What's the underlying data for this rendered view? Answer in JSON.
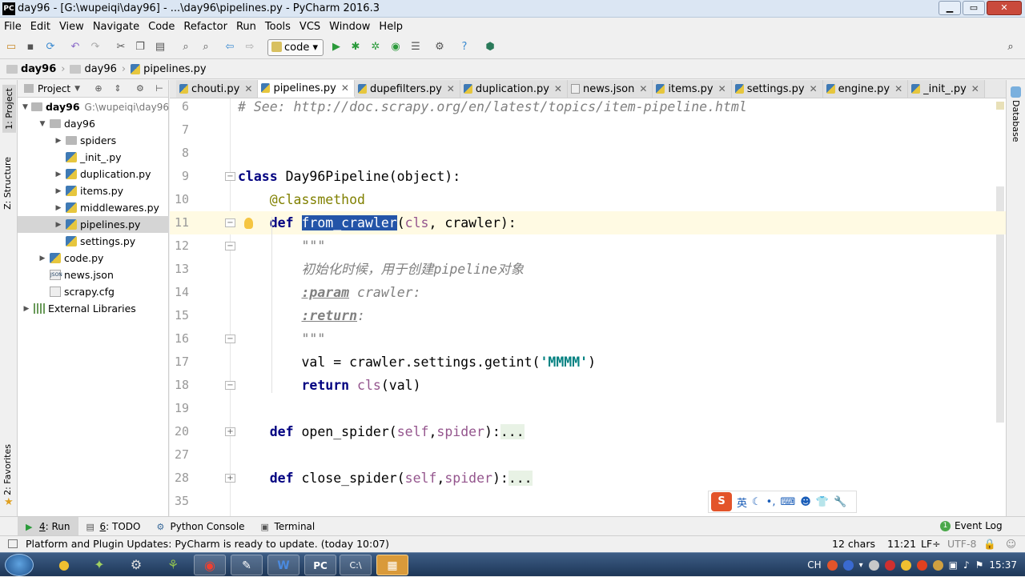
{
  "window": {
    "title": "day96 - [G:\\wupeiqi\\day96] - ...\\day96\\pipelines.py - PyCharm 2016.3",
    "app_icon": "PC"
  },
  "menu": [
    "File",
    "Edit",
    "View",
    "Navigate",
    "Code",
    "Refactor",
    "Run",
    "Tools",
    "VCS",
    "Window",
    "Help"
  ],
  "toolbar": {
    "run_config": "code"
  },
  "breadcrumb": [
    "day96",
    "day96",
    "pipelines.py"
  ],
  "side_tabs": {
    "project": "1: Project",
    "structure": "Z: Structure",
    "favorites": "2: Favorites",
    "database": "Database"
  },
  "project_panel": {
    "header": "Project",
    "tree": [
      {
        "label": "day96",
        "path": "G:\\wupeiqi\\day96",
        "type": "folder",
        "arrow": "▼",
        "indent": 0,
        "bold": true
      },
      {
        "label": "day96",
        "type": "folder",
        "arrow": "▼",
        "indent": 1
      },
      {
        "label": "spiders",
        "type": "folder",
        "arrow": "▶",
        "indent": 2
      },
      {
        "label": "_init_.py",
        "type": "py",
        "arrow": "",
        "indent": 2
      },
      {
        "label": "duplication.py",
        "type": "py",
        "arrow": "▶",
        "indent": 2
      },
      {
        "label": "items.py",
        "type": "py",
        "arrow": "▶",
        "indent": 2
      },
      {
        "label": "middlewares.py",
        "type": "py",
        "arrow": "▶",
        "indent": 2
      },
      {
        "label": "pipelines.py",
        "type": "py",
        "arrow": "▶",
        "indent": 2,
        "selected": true
      },
      {
        "label": "settings.py",
        "type": "py",
        "arrow": "",
        "indent": 2
      },
      {
        "label": "code.py",
        "type": "py",
        "arrow": "▶",
        "indent": 1
      },
      {
        "label": "news.json",
        "type": "json",
        "arrow": "",
        "indent": 1
      },
      {
        "label": "scrapy.cfg",
        "type": "cfg",
        "arrow": "",
        "indent": 1
      },
      {
        "label": "External Libraries",
        "type": "lib",
        "arrow": "▶",
        "indent": 0
      }
    ]
  },
  "editor_tabs": [
    {
      "label": "chouti.py",
      "type": "py"
    },
    {
      "label": "pipelines.py",
      "type": "py",
      "active": true
    },
    {
      "label": "dupefilters.py",
      "type": "py"
    },
    {
      "label": "duplication.py",
      "type": "py"
    },
    {
      "label": "news.json",
      "type": "json"
    },
    {
      "label": "items.py",
      "type": "py"
    },
    {
      "label": "settings.py",
      "type": "py"
    },
    {
      "label": "engine.py",
      "type": "py"
    },
    {
      "label": "_init_.py",
      "type": "py"
    }
  ],
  "code_lines": [
    {
      "n": "6",
      "html": "<span class=\"cmt\"># See: http://doc.scrapy.org/en/latest/topics/item-pipeline.html</span>"
    },
    {
      "n": "7",
      "html": ""
    },
    {
      "n": "8",
      "html": ""
    },
    {
      "n": "9",
      "html": "<span class=\"kw\">class</span> Day96Pipeline(object):"
    },
    {
      "n": "10",
      "html": "    <span class=\"dec\">@classmethod</span>"
    },
    {
      "n": "11",
      "html": "    <span class=\"kw\">def</span> <span class=\"hl\">from_crawler</span>(<span class=\"slf\">cls</span>, crawler):",
      "current": true
    },
    {
      "n": "12",
      "html": "        <span class=\"doc\">\"\"\"</span>"
    },
    {
      "n": "13",
      "html": "        <span class=\"doc\">初始化时候，用于创建pipeline对象</span>"
    },
    {
      "n": "14",
      "html": "        <span class=\"doc\"><b class=\"under\">:param</b> crawler:</span>"
    },
    {
      "n": "15",
      "html": "        <span class=\"doc\"><b class=\"under\">:return</b>:</span>"
    },
    {
      "n": "16",
      "html": "        <span class=\"doc\">\"\"\"</span>"
    },
    {
      "n": "17",
      "html": "        val = crawler.settings.getint(<span class=\"str\">'MMMM'</span>)"
    },
    {
      "n": "18",
      "html": "        <span class=\"kw\">return</span> <span class=\"slf\">cls</span>(val)"
    },
    {
      "n": "19",
      "html": ""
    },
    {
      "n": "20",
      "html": "    <span class=\"kw\">def</span> open_spider(<span class=\"slf\">self</span>,<span class=\"slf\">spider</span>):<span class=\"collapsed\">...</span>"
    },
    {
      "n": "27",
      "html": ""
    },
    {
      "n": "28",
      "html": "    <span class=\"kw\">def</span> close_spider(<span class=\"slf\">self</span>,<span class=\"slf\">spider</span>):<span class=\"collapsed\">...</span>"
    },
    {
      "n": "35",
      "html": ""
    }
  ],
  "ime_bar": {
    "logo": "S",
    "lang": "英"
  },
  "bottom_tabs": [
    {
      "num": "4",
      "label": ": Run",
      "active": true
    },
    {
      "num": "6",
      "label": ": TODO"
    },
    {
      "num": "",
      "label": "Python Console"
    },
    {
      "num": "",
      "label": "Terminal"
    }
  ],
  "event_log": "Event Log",
  "status": {
    "message": "Platform and Plugin Updates: PyCharm is ready to update. (today 10:07)",
    "selection": "12 chars",
    "position": "11:21",
    "line_sep": "LF÷",
    "encoding": "UTF-8"
  },
  "taskbar": {
    "time": "15:37",
    "lang": "CH"
  },
  "colors": {
    "selection": "#2354a8",
    "current_line": "#fffae3",
    "keyword": "#000080",
    "string": "#008080"
  }
}
